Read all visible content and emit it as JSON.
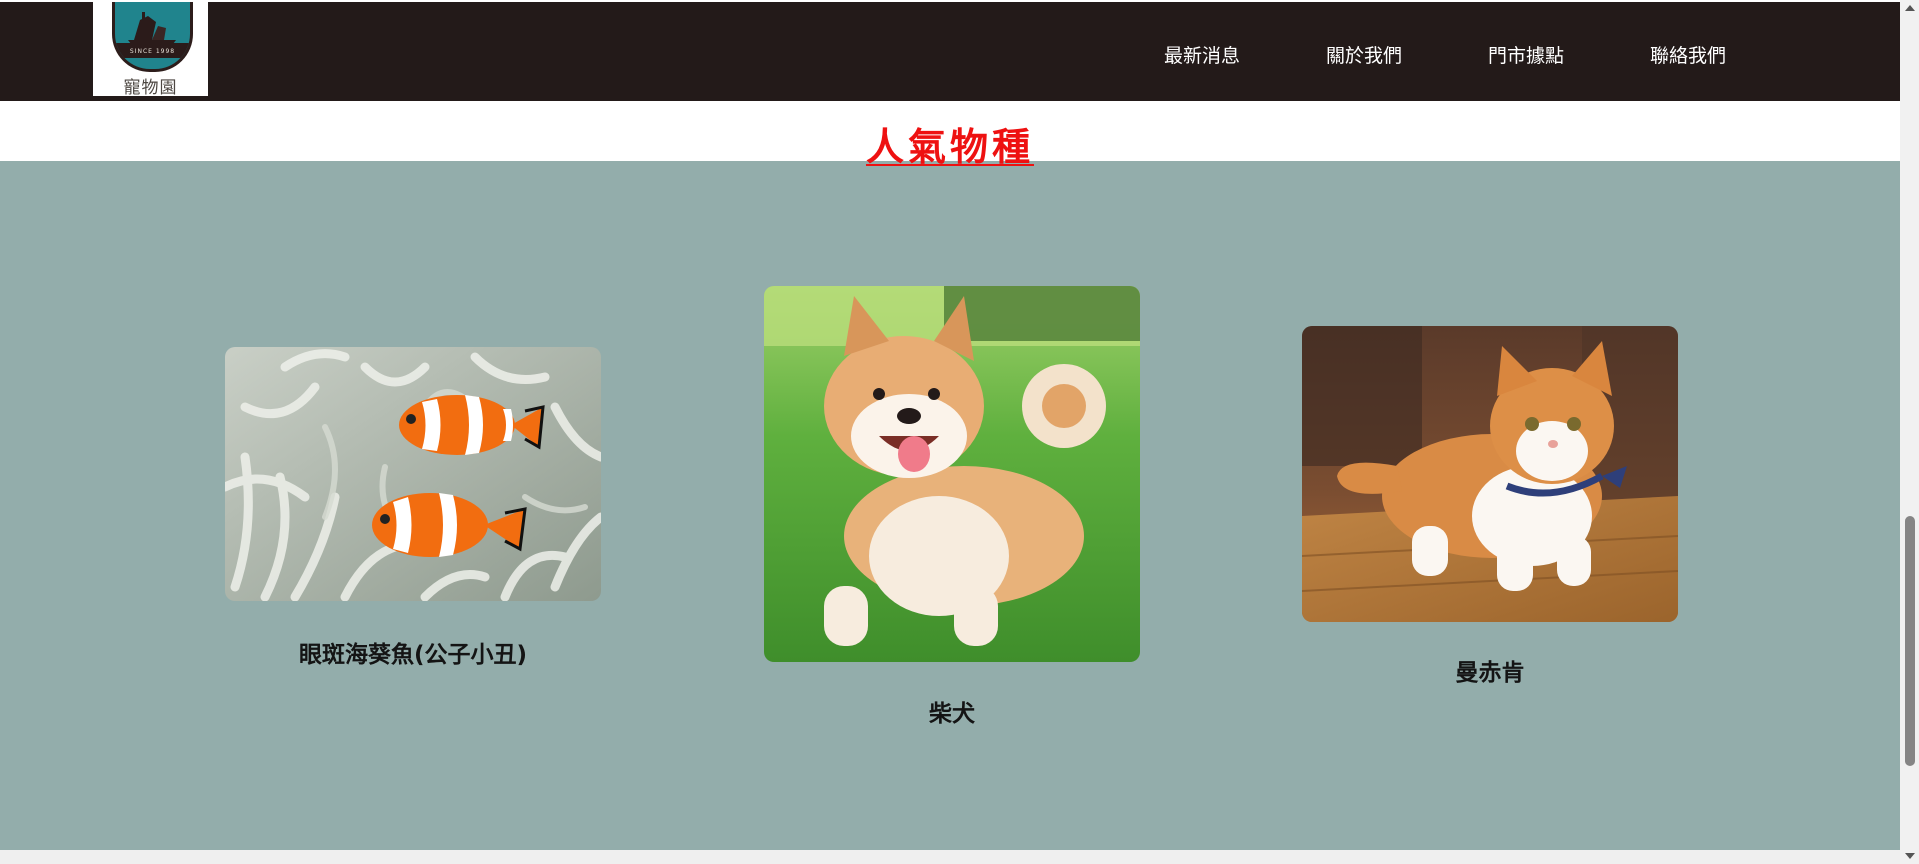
{
  "site": {
    "logo": {
      "name": "寵物園",
      "emblem_text": "SINCE 1998"
    },
    "nav": [
      {
        "label": "最新消息"
      },
      {
        "label": "關於我們"
      },
      {
        "label": "門市據點"
      },
      {
        "label": "聯絡我們"
      }
    ]
  },
  "section": {
    "title": "人氣物種",
    "pets": [
      {
        "name": "眼斑海葵魚(公子小丑)",
        "icon": "clownfish-photo"
      },
      {
        "name": "柴犬",
        "icon": "shiba-inu-photo"
      },
      {
        "name": "曼赤肯",
        "icon": "munchkin-cat-photo"
      }
    ]
  },
  "colors": {
    "header_bg": "#231a19",
    "section_bg": "#93adab",
    "title_color": "#ee1111",
    "nav_text": "#ffffff"
  }
}
